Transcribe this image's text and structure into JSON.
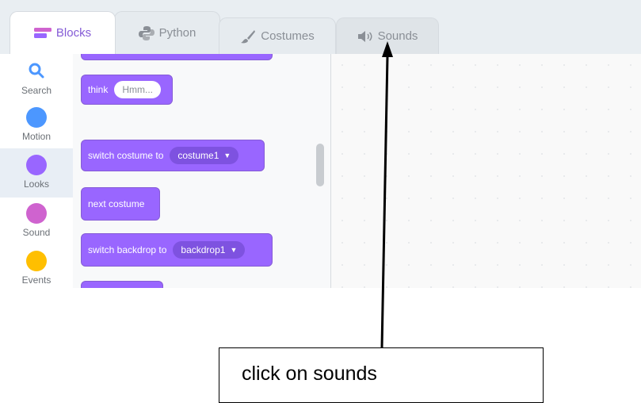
{
  "tabs": [
    {
      "label": "Blocks",
      "icon": "blocks-icon",
      "active": true
    },
    {
      "label": "Python",
      "icon": "python-icon",
      "active": false
    },
    {
      "label": "Costumes",
      "icon": "brush-icon",
      "active": false
    },
    {
      "label": "Sounds",
      "icon": "speaker-icon",
      "active": false
    }
  ],
  "categories": [
    {
      "label": "Search",
      "icon": "search-icon"
    },
    {
      "label": "Motion",
      "color": "#4c97ff"
    },
    {
      "label": "Looks",
      "color": "#9966ff",
      "selected": true
    },
    {
      "label": "Sound",
      "color": "#cf63cf"
    },
    {
      "label": "Events",
      "color": "#ffbf00"
    }
  ],
  "blocks": {
    "think": {
      "label": "think",
      "input": "Hmm..."
    },
    "switch_costume": {
      "label": "switch costume to",
      "value": "costume1"
    },
    "next_costume": {
      "label": "next costume"
    },
    "switch_backdrop": {
      "label": "switch backdrop to",
      "value": "backdrop1"
    }
  },
  "callout": {
    "text": "click on sounds"
  },
  "colors": {
    "looks": "#9966ff",
    "looks_dark": "#855cd6",
    "active_tab": "#855cd6"
  }
}
